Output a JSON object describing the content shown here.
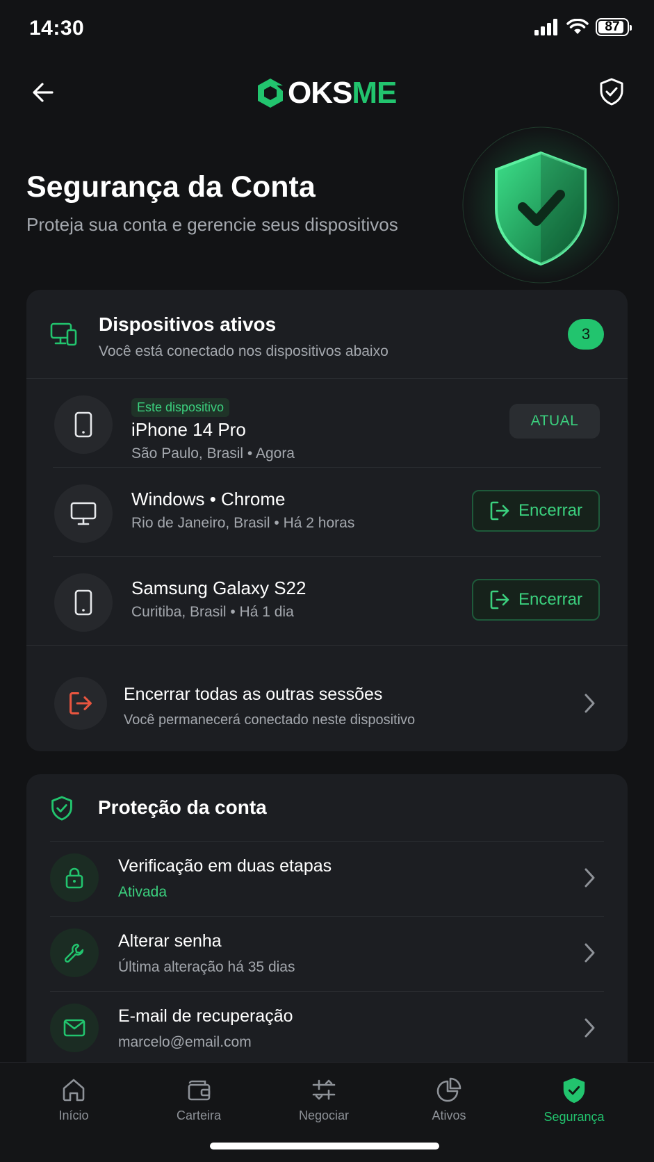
{
  "status_bar": {
    "time": "14:30",
    "battery": "87"
  },
  "header": {
    "logo_prefix": "OKS",
    "logo_suffix": "ME"
  },
  "hero": {
    "title": "Segurança da Conta",
    "subtitle": "Proteja sua conta e gerencie seus dispositivos"
  },
  "devices": {
    "title": "Dispositivos ativos",
    "subtitle": "Você está conectado nos dispositivos abaixo",
    "count": "3",
    "items": [
      {
        "tag": "Este dispositivo",
        "name": "iPhone 14 Pro",
        "meta": "São Paulo, Brasil • Agora",
        "status": "ATUAL",
        "icon": "smartphone-icon"
      },
      {
        "name": "Windows • Chrome",
        "meta": "Rio de Janeiro, Brasil • Há 2 horas",
        "action": "Encerrar",
        "icon": "monitor-icon"
      },
      {
        "name": "Samsung Galaxy S22",
        "meta": "Curitiba, Brasil • Há 1 dia",
        "action": "Encerrar",
        "icon": "smartphone-icon"
      }
    ],
    "end_all": {
      "title": "Encerrar todas as outras sessões",
      "subtitle": "Você permanecerá conectado neste dispositivo"
    }
  },
  "protection": {
    "title": "Proteção da conta",
    "items": [
      {
        "title": "Verificação em duas etapas",
        "subtitle": "Ativada",
        "icon": "lock-icon"
      },
      {
        "title": "Alterar senha",
        "subtitle": "Última alteração há 35 dias",
        "icon": "wrench-icon"
      },
      {
        "title": "E-mail de recuperação",
        "subtitle": "marcelo@email.com",
        "icon": "mail-icon"
      }
    ]
  },
  "nav": {
    "items": [
      {
        "label": "Início",
        "icon": "home-icon"
      },
      {
        "label": "Carteira",
        "icon": "wallet-icon"
      },
      {
        "label": "Negociar",
        "icon": "trade-icon"
      },
      {
        "label": "Ativos",
        "icon": "pie-chart-icon"
      },
      {
        "label": "Segurança",
        "icon": "shield-icon",
        "active": true
      }
    ]
  },
  "colors": {
    "accent": "#22c46e",
    "danger": "#e8553f",
    "background": "#121315",
    "card": "#1c1e22"
  }
}
